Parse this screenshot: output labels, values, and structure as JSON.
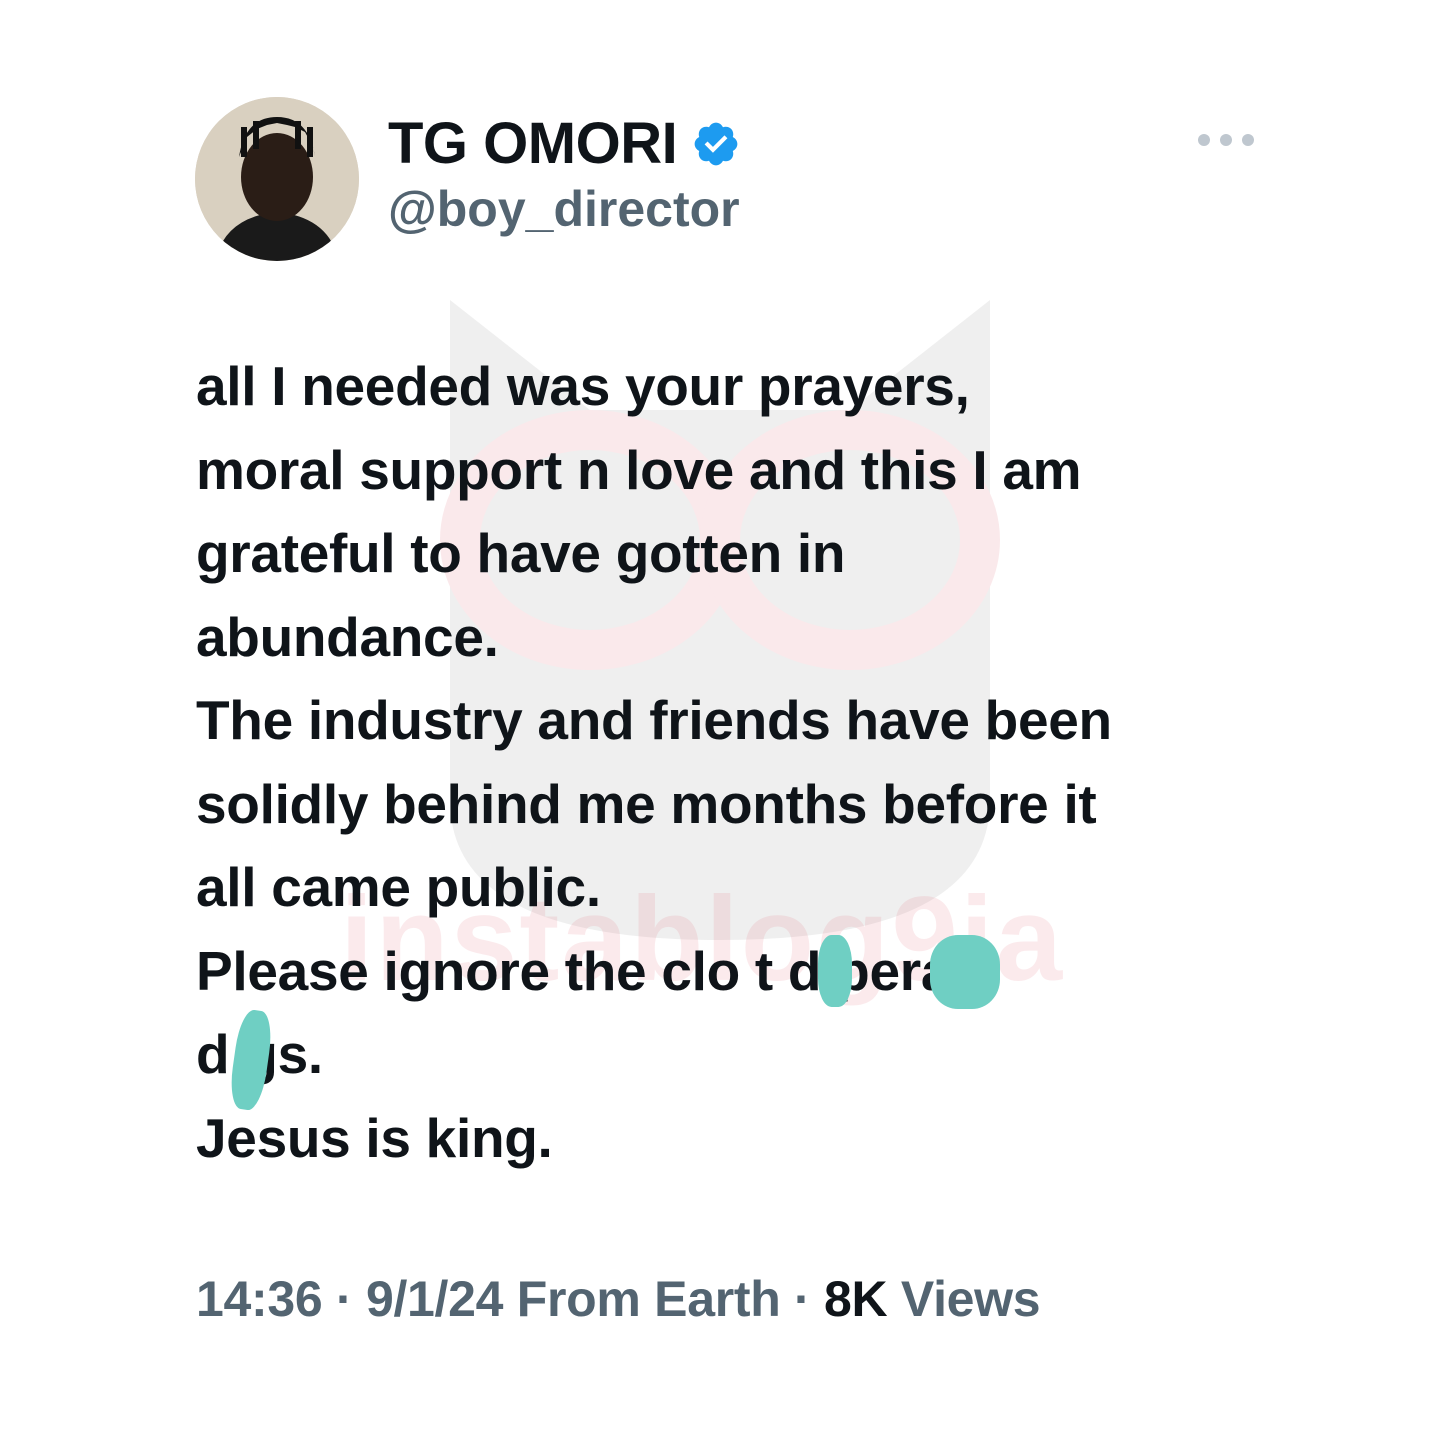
{
  "tweet": {
    "author": {
      "display_name": "TG OMORI",
      "handle": "@boy_director",
      "verified": true,
      "avatar_icon": "profile-photo"
    },
    "lines": [
      "all I needed was your prayers,",
      "moral support n love and this I am",
      "grateful to have gotten in",
      "abundance.",
      "The industry and friends have been",
      "solidly behind me months before it",
      "all came public.",
      "Please ignore the clo t d perate",
      "d gs.",
      "Jesus is king."
    ],
    "redaction_color": "#6fcfc3",
    "meta": {
      "time": "14:36",
      "separator": "·",
      "date": "9/1/24",
      "source": "From Earth",
      "views_count": "8K",
      "views_label": "Views"
    }
  },
  "watermark": {
    "text": "instablog9ja"
  },
  "colors": {
    "text_primary": "#0f1419",
    "text_secondary": "#536471",
    "verified_blue": "#1d9bf0"
  }
}
